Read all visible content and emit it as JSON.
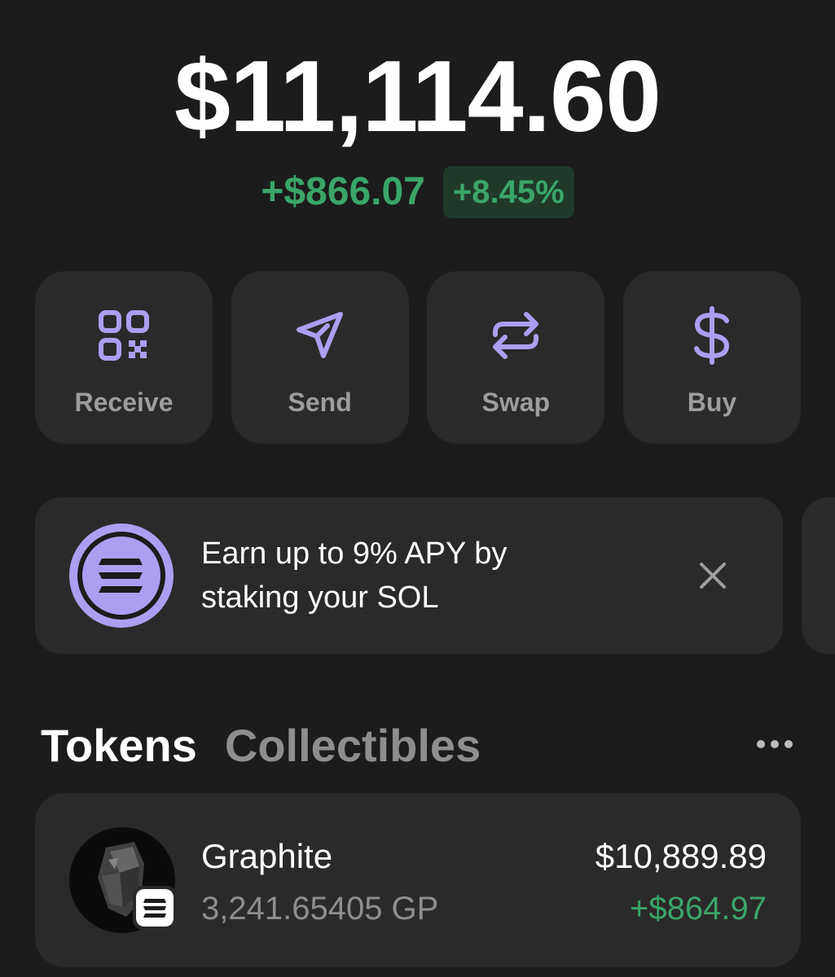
{
  "balance": {
    "total": "$11,114.60",
    "change_amount": "+$866.07",
    "change_percent": "+8.45%"
  },
  "actions": [
    {
      "label": "Receive",
      "icon": "qr-code-icon"
    },
    {
      "label": "Send",
      "icon": "send-icon"
    },
    {
      "label": "Swap",
      "icon": "swap-icon"
    },
    {
      "label": "Buy",
      "icon": "dollar-icon"
    }
  ],
  "promo": {
    "text_line1": "Earn up to 9% APY by",
    "text_line2": "staking your SOL",
    "icon": "solana-logo-icon",
    "close_icon": "close-icon"
  },
  "tabs": [
    {
      "label": "Tokens",
      "active": true
    },
    {
      "label": "Collectibles",
      "active": false
    }
  ],
  "tokens": [
    {
      "name": "Graphite",
      "quantity": "3,241.65405 GP",
      "value": "$10,889.89",
      "change": "+$864.97"
    }
  ],
  "colors": {
    "background": "#1c1c1c",
    "card": "#2a2a2a",
    "accent": "#ab9ff2",
    "positive": "#3aa56a",
    "muted": "#8e8e8e"
  }
}
